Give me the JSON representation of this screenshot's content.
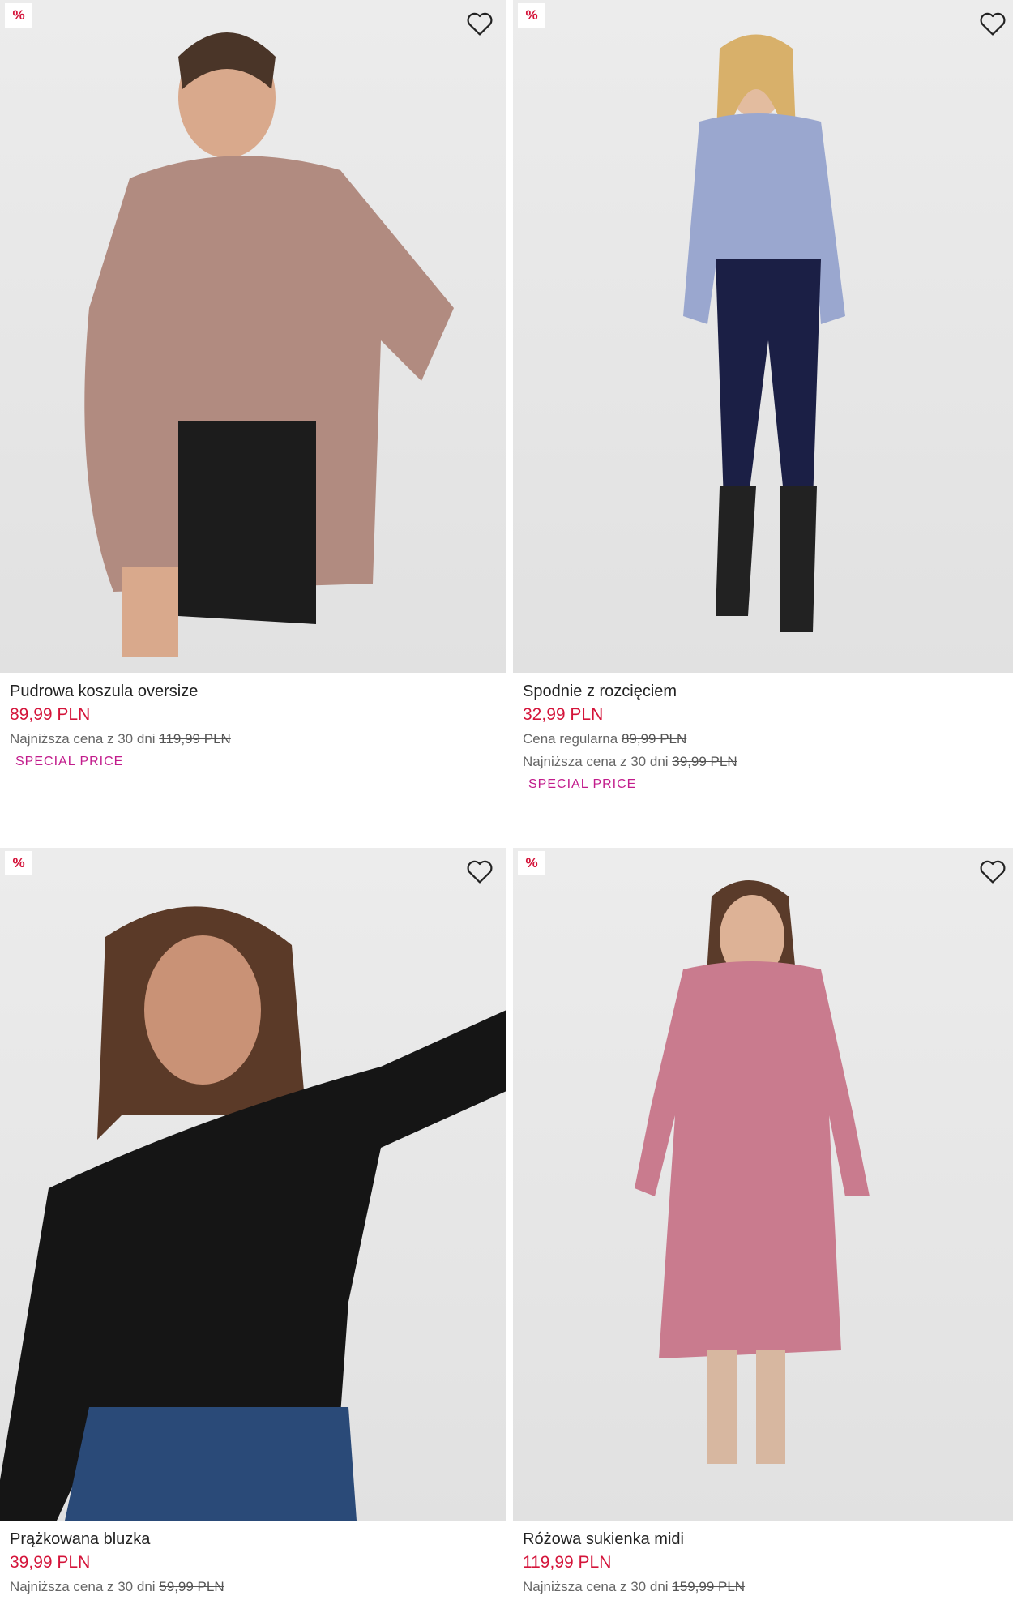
{
  "products": [
    {
      "badge": "%",
      "name": "Pudrowa koszula oversize",
      "price": "89,99 PLN",
      "lowest_label": "Najniższa cena z 30 dni",
      "lowest_value": "119,99 PLN",
      "tag": "SPECIAL PRICE"
    },
    {
      "badge": "%",
      "name": "Spodnie z rozcięciem",
      "price": "32,99 PLN",
      "regular_label": "Cena regularna",
      "regular_value": "89,99 PLN",
      "lowest_label": "Najniższa cena z 30 dni",
      "lowest_value": "39,99 PLN",
      "tag": "SPECIAL PRICE"
    },
    {
      "badge": "%",
      "name": "Prążkowana bluzka",
      "price": "39,99 PLN",
      "lowest_label": "Najniższa cena z 30 dni",
      "lowest_value": "59,99 PLN"
    },
    {
      "badge": "%",
      "name": "Różowa sukienka midi",
      "price": "119,99 PLN",
      "lowest_label": "Najniższa cena z 30 dni",
      "lowest_value": "159,99 PLN"
    }
  ],
  "icons": {
    "wishlist": "heart-outline-icon",
    "discount": "percent-badge"
  },
  "colors": {
    "price": "#d4143a",
    "special_tag": "#c21c8c",
    "badge_text": "#d4143a"
  }
}
